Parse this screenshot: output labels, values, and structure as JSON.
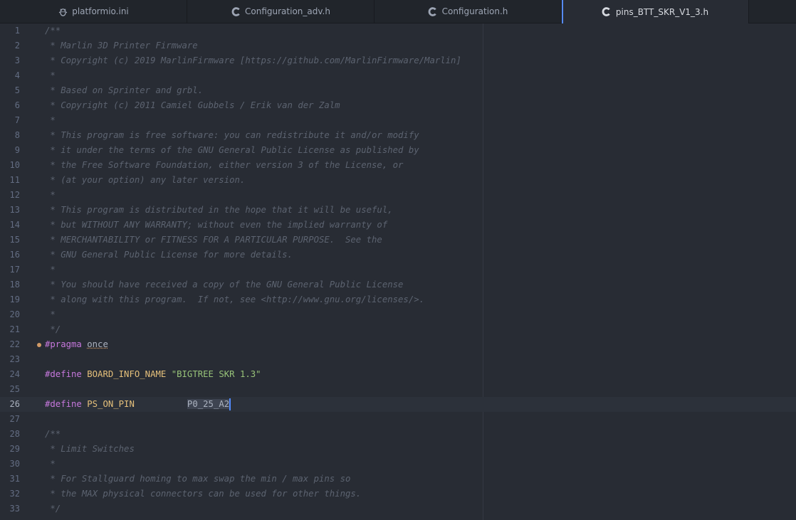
{
  "tabs": [
    {
      "label": "platformio.ini",
      "icon": "bug-icon"
    },
    {
      "label": "Configuration_adv.h",
      "icon": "c-file-icon"
    },
    {
      "label": "Configuration.h",
      "icon": "c-file-icon"
    },
    {
      "label": "pins_BTT_SKR_V1_3.h",
      "icon": "c-file-icon"
    }
  ],
  "active_tab_index": 3,
  "colors": {
    "accent": "#568af2",
    "background": "#282c34",
    "comment": "#5c6370",
    "keyword": "#c678dd",
    "macro_name": "#e5c07b",
    "string": "#98c379",
    "modified_dot": "#d19a66"
  },
  "cursor_line": 26,
  "lines": [
    {
      "num": "1",
      "segs": [
        {
          "t": "/**",
          "c": "comment"
        }
      ]
    },
    {
      "num": "2",
      "segs": [
        {
          "t": " * Marlin 3D Printer Firmware",
          "c": "comment"
        }
      ]
    },
    {
      "num": "3",
      "segs": [
        {
          "t": " * Copyright (c) 2019 MarlinFirmware [https://github.com/MarlinFirmware/Marlin]",
          "c": "comment"
        }
      ]
    },
    {
      "num": "4",
      "segs": [
        {
          "t": " *",
          "c": "comment"
        }
      ]
    },
    {
      "num": "5",
      "segs": [
        {
          "t": " * Based on Sprinter and grbl.",
          "c": "comment"
        }
      ]
    },
    {
      "num": "6",
      "segs": [
        {
          "t": " * Copyright (c) 2011 Camiel Gubbels / Erik van der Zalm",
          "c": "comment"
        }
      ]
    },
    {
      "num": "7",
      "segs": [
        {
          "t": " *",
          "c": "comment"
        }
      ]
    },
    {
      "num": "8",
      "segs": [
        {
          "t": " * This program is free software: you can redistribute it and/or modify",
          "c": "comment"
        }
      ]
    },
    {
      "num": "9",
      "segs": [
        {
          "t": " * it under the terms of the GNU General Public License as published by",
          "c": "comment"
        }
      ]
    },
    {
      "num": "10",
      "segs": [
        {
          "t": " * the Free Software Foundation, either version 3 of the License, or",
          "c": "comment"
        }
      ]
    },
    {
      "num": "11",
      "segs": [
        {
          "t": " * (at your option) any later version.",
          "c": "comment"
        }
      ]
    },
    {
      "num": "12",
      "segs": [
        {
          "t": " *",
          "c": "comment"
        }
      ]
    },
    {
      "num": "13",
      "segs": [
        {
          "t": " * This program is distributed in the hope that it will be useful,",
          "c": "comment"
        }
      ]
    },
    {
      "num": "14",
      "segs": [
        {
          "t": " * but WITHOUT ANY WARRANTY; without even the implied warranty of",
          "c": "comment"
        }
      ]
    },
    {
      "num": "15",
      "segs": [
        {
          "t": " * MERCHANTABILITY or FITNESS FOR A PARTICULAR PURPOSE.  See the",
          "c": "comment"
        }
      ]
    },
    {
      "num": "16",
      "segs": [
        {
          "t": " * GNU General Public License for more details.",
          "c": "comment"
        }
      ]
    },
    {
      "num": "17",
      "segs": [
        {
          "t": " *",
          "c": "comment"
        }
      ]
    },
    {
      "num": "18",
      "segs": [
        {
          "t": " * You should have received a copy of the GNU General Public License",
          "c": "comment"
        }
      ]
    },
    {
      "num": "19",
      "segs": [
        {
          "t": " * along with this program.  If not, see <http://www.gnu.org/licenses/>.",
          "c": "comment"
        }
      ]
    },
    {
      "num": "20",
      "segs": [
        {
          "t": " *",
          "c": "comment"
        }
      ]
    },
    {
      "num": "21",
      "segs": [
        {
          "t": " */",
          "c": "comment"
        }
      ]
    },
    {
      "num": "22",
      "modified": true,
      "segs": [
        {
          "t": "#pragma",
          "c": "keyword"
        },
        {
          "t": " ",
          "c": "plain"
        },
        {
          "t": "once",
          "c": "squiggle"
        }
      ]
    },
    {
      "num": "23",
      "segs": []
    },
    {
      "num": "24",
      "segs": [
        {
          "t": "#define",
          "c": "keyword"
        },
        {
          "t": " ",
          "c": "plain"
        },
        {
          "t": "BOARD_INFO_NAME",
          "c": "name"
        },
        {
          "t": " ",
          "c": "plain"
        },
        {
          "t": "\"BIGTREE SKR 1.3\"",
          "c": "string"
        }
      ]
    },
    {
      "num": "25",
      "segs": []
    },
    {
      "num": "26",
      "segs": [
        {
          "t": "#define",
          "c": "keyword"
        },
        {
          "t": " ",
          "c": "plain"
        },
        {
          "t": "PS_ON_PIN",
          "c": "name"
        },
        {
          "t": "          ",
          "c": "plain"
        },
        {
          "t": "P0_25_A2",
          "c": "sel"
        },
        {
          "t": "",
          "c": "caret"
        }
      ]
    },
    {
      "num": "27",
      "segs": []
    },
    {
      "num": "28",
      "segs": [
        {
          "t": "/**",
          "c": "comment"
        }
      ]
    },
    {
      "num": "29",
      "segs": [
        {
          "t": " * Limit Switches",
          "c": "comment"
        }
      ]
    },
    {
      "num": "30",
      "segs": [
        {
          "t": " *",
          "c": "comment"
        }
      ]
    },
    {
      "num": "31",
      "segs": [
        {
          "t": " * For Stallguard homing to max swap the min / max pins so",
          "c": "comment"
        }
      ]
    },
    {
      "num": "32",
      "segs": [
        {
          "t": " * the MAX physical connectors can be used for other things.",
          "c": "comment"
        }
      ]
    },
    {
      "num": "33",
      "segs": [
        {
          "t": " */",
          "c": "comment"
        }
      ]
    }
  ]
}
